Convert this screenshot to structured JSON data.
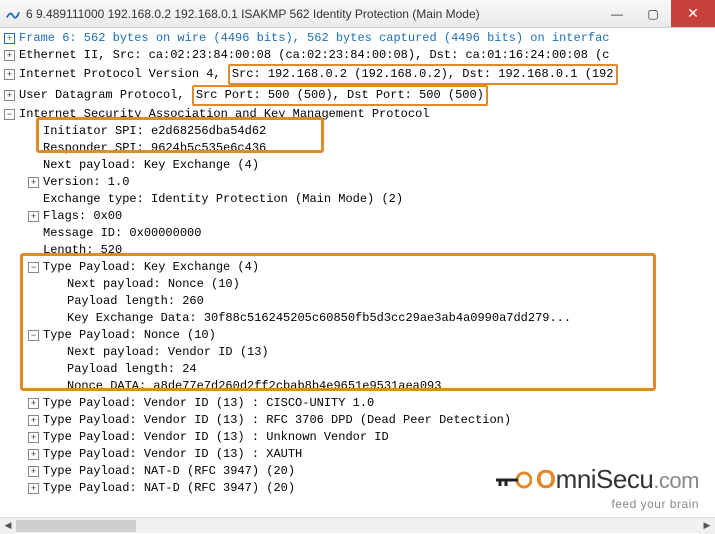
{
  "titlebar": {
    "title": "6 9.489111000 192.168.0.2 192.168.0.1 ISAKMP 562 Identity Protection (Main Mode)"
  },
  "lines": {
    "frame": "Frame 6: 562 bytes on wire (4496 bits), 562 bytes captured (4496 bits) on interfac",
    "eth": "Ethernet II, Src: ca:02:23:84:00:08 (ca:02:23:84:00:08), Dst: ca:01:16:24:00:08 (c",
    "ip_pre": "Internet Protocol Version 4, ",
    "ip_hl": "Src: 192.168.0.2 (192.168.0.2), Dst: 192.168.0.1 (192",
    "udp_pre": "User Datagram Protocol, ",
    "udp_hl": "Src Port: 500 (500), Dst Port: 500 (500)",
    "isakmp": "Internet Security Association and Key Management Protocol",
    "init_spi": "Initiator SPI: e2d68256dba54d62",
    "resp_spi": "Responder SPI: 9624b5c535e6c436",
    "next_pl": "Next payload: Key Exchange (4)",
    "version": "Version: 1.0",
    "exch": "Exchange type: Identity Protection (Main Mode) (2)",
    "flags": "Flags: 0x00",
    "msgid": "Message ID: 0x00000000",
    "length": "Length: 520",
    "ke_head": "Type Payload: Key Exchange (4)",
    "ke_next": "Next payload: Nonce (10)",
    "ke_len": "Payload length: 260",
    "ke_data": "Key Exchange Data: 30f88c516245205c60850fb5d3cc29ae3ab4a0990a7dd279...",
    "nonce_head": "Type Payload: Nonce (10)",
    "nonce_next": "Next payload: Vendor ID (13)",
    "nonce_len": "Payload length: 24",
    "nonce_data": "Nonce DATA: a8de77e7d260d2ff2cbab8b4e9651e9531aea093",
    "vid1": "Type Payload: Vendor ID (13) : CISCO-UNITY 1.0",
    "vid2": "Type Payload: Vendor ID (13) : RFC 3706 DPD (Dead Peer Detection)",
    "vid3": "Type Payload: Vendor ID (13) : Unknown Vendor ID",
    "vid4": "Type Payload: Vendor ID (13) : XAUTH",
    "natd1": "Type Payload: NAT-D (RFC 3947) (20)",
    "natd2": "Type Payload: NAT-D (RFC 3947) (20)"
  },
  "logo": {
    "brand_o": "O",
    "brand_text": "mniSecu",
    "brand_dom": ".com",
    "tagline": "feed your brain"
  }
}
